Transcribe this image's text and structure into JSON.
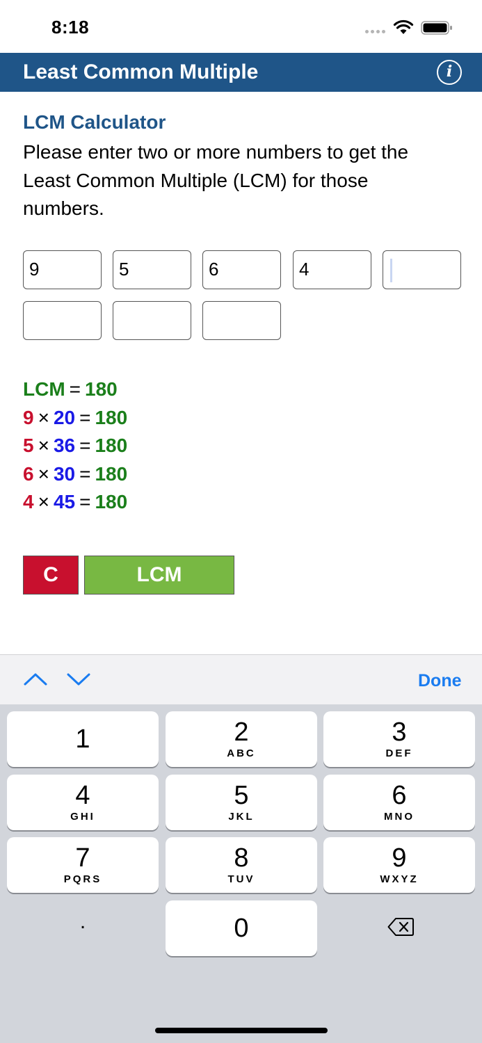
{
  "status_bar": {
    "time": "8:18"
  },
  "nav": {
    "title": "Least Common Multiple",
    "info_label": "i"
  },
  "content": {
    "section_title": "LCM Calculator",
    "description": "Please enter two or more numbers to get the Least Common Multiple (LCM) for those numbers."
  },
  "inputs": [
    "9",
    "5",
    "6",
    "4",
    "",
    "",
    "",
    ""
  ],
  "results": {
    "lcm_label": "LCM",
    "lcm_value": "180",
    "rows": [
      {
        "number": "9",
        "multiplier": "20",
        "result": "180"
      },
      {
        "number": "5",
        "multiplier": "36",
        "result": "180"
      },
      {
        "number": "6",
        "multiplier": "30",
        "result": "180"
      },
      {
        "number": "4",
        "multiplier": "45",
        "result": "180"
      }
    ],
    "times_symbol": "×",
    "equals_symbol": "="
  },
  "buttons": {
    "clear_label": "C",
    "lcm_label": "LCM"
  },
  "accessory": {
    "done_label": "Done"
  },
  "keypad": {
    "keys": [
      {
        "digit": "1",
        "letters": ""
      },
      {
        "digit": "2",
        "letters": "ABC"
      },
      {
        "digit": "3",
        "letters": "DEF"
      },
      {
        "digit": "4",
        "letters": "GHI"
      },
      {
        "digit": "5",
        "letters": "JKL"
      },
      {
        "digit": "6",
        "letters": "MNO"
      },
      {
        "digit": "7",
        "letters": "PQRS"
      },
      {
        "digit": "8",
        "letters": "TUV"
      },
      {
        "digit": "9",
        "letters": "WXYZ"
      }
    ],
    "dot_label": ".",
    "zero_label": "0"
  },
  "colors": {
    "nav_bg": "#1f5588",
    "accent_blue_text": "#1f5588",
    "clear_red": "#c8102e",
    "lcm_green": "#78b843",
    "result_green": "#1b7f1b",
    "number_red": "#c8102e",
    "multiplier_blue": "#1a1ae6",
    "done_blue": "#1a7cf0"
  }
}
